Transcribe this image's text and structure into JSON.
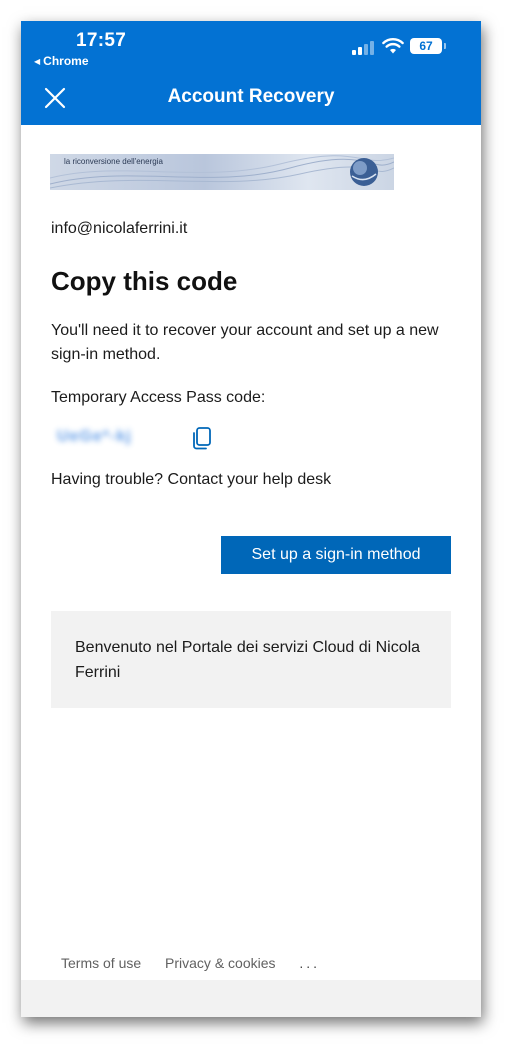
{
  "status_bar": {
    "time": "17:57",
    "back_app": "Chrome",
    "battery": "67"
  },
  "header": {
    "title": "Account Recovery",
    "close_icon": "close-icon"
  },
  "banner": {
    "text": "la riconversione dell'energia"
  },
  "account": {
    "email": "info@nicolaferrini.it"
  },
  "main": {
    "heading": "Copy this code",
    "description": "You'll need it to recover your account and set up a new sign-in method.",
    "tap_label": "Temporary Access Pass code:",
    "tap_code_blurred": "UeGe*-kj",
    "copy_icon": "copy-icon",
    "trouble_text": "Having trouble? Contact your help desk",
    "primary_button": "Set up a sign-in method"
  },
  "welcome": {
    "text": "Benvenuto nel Portale dei servizi Cloud di Nicola Ferrini"
  },
  "footer": {
    "terms": "Terms of use",
    "privacy": "Privacy & cookies",
    "more": "..."
  },
  "colors": {
    "brand_blue": "#0372d3",
    "button_blue": "#0067b8",
    "panel_gray": "#f2f2f2"
  }
}
